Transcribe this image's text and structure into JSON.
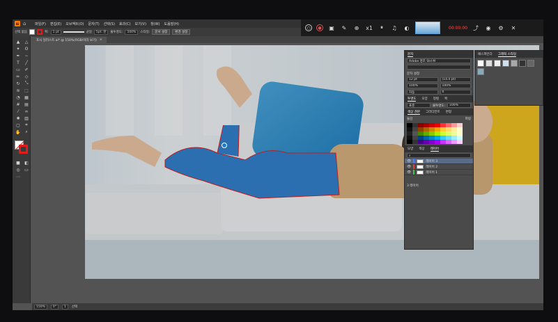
{
  "menubar": {
    "items": [
      "파일(F)",
      "편집(E)",
      "오브젝트(O)",
      "문자(T)",
      "선택(S)",
      "효과(C)",
      "보기(V)",
      "창(W)",
      "도움말(H)"
    ]
  },
  "controlbar": {
    "label": "선택 없음",
    "stroke_label": "획:",
    "stroke_weight": "1 pt",
    "brush_label": "균일",
    "point_label": "5pt. 원",
    "opacity_label": "불투명도:",
    "opacity_value": "100%",
    "style_label": "스타일:",
    "doc_setup": "문서 설정",
    "prefs": "환경 설정"
  },
  "tab": {
    "title": "포시 일러스트.ai* @ 150%(RGB/미리 보기)",
    "close": "×"
  },
  "recorder": {
    "time": "00:00:00",
    "zoom": "x1"
  },
  "panel_char": {
    "tabs": [
      "문자",
      "패스파인더",
      "그래픽 스타일"
    ],
    "font": "Adobe 명조 Std M",
    "font_style": "",
    "size": "12 pt",
    "leading": "(14.4 pt)",
    "tracking": "0",
    "scale_h": "100%",
    "scale_v": "100%",
    "kerning": "자동",
    "baseline": "0 pt",
    "rotate": "0°",
    "m_label": "문자 설정"
  },
  "panel_trans": {
    "tabs": [
      "투명도",
      "모양",
      "정렬",
      "획"
    ],
    "mode": "표준",
    "opacity_label": "불투명도:",
    "opacity": "100%"
  },
  "panel_swatch": {
    "tabs": [
      "색상 견본",
      "그라디언트",
      "변형"
    ],
    "group1": "물감",
    "group2": "파랑"
  },
  "panel_layers": {
    "tabs": [
      "모양",
      "색상",
      "레이어"
    ],
    "layers": [
      "레이어 3",
      "레이어 2",
      "레이어 1"
    ],
    "count": "3 레이어"
  },
  "status": {
    "zoom": "150%",
    "rotate": "0°",
    "page": "1",
    "tool": "선택"
  },
  "colors": {
    "accent": "#e01c1c",
    "ui_bg": "#535353",
    "panel": "#4a4a4a"
  }
}
